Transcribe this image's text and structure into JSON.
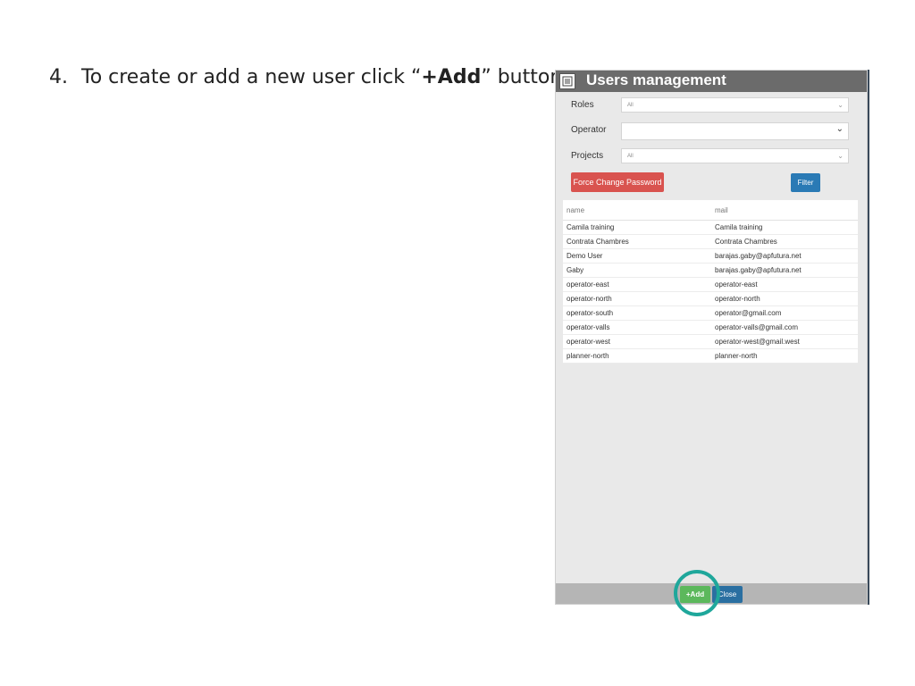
{
  "instruction": {
    "number": "4.",
    "before": "To create or add a new user click “",
    "emphasis": "+Add",
    "after": "” button."
  },
  "window": {
    "title": "Users management",
    "title_icon": "list-icon"
  },
  "filters": {
    "roles_label": "Roles",
    "roles_value": "All",
    "operator_label": "Operator",
    "operator_value": "",
    "projects_label": "Projects",
    "projects_value": "All"
  },
  "buttons": {
    "force_change_password": "Force Change Password",
    "filter": "Filter",
    "add": "+Add",
    "close": "Close"
  },
  "table": {
    "columns": [
      "name",
      "mail"
    ],
    "rows": [
      [
        "Camila training",
        "Camila training"
      ],
      [
        "Contrata Chambres",
        "Contrata Chambres"
      ],
      [
        "Demo User",
        "barajas.gaby@apfutura.net"
      ],
      [
        "Gaby",
        "barajas.gaby@apfutura.net"
      ],
      [
        "operator-east",
        "operator-east"
      ],
      [
        "operator-north",
        "operator-north"
      ],
      [
        "operator-south",
        "operator@gmail.com"
      ],
      [
        "operator-valls",
        "operator-valls@gmail.com"
      ],
      [
        "operator-west",
        "operator-west@gmail.west"
      ],
      [
        "planner-north",
        "planner-north"
      ]
    ]
  },
  "colors": {
    "highlight_ring": "#1fa79b",
    "add_button": "#5cb85c",
    "force_button": "#d9534f",
    "filter_button": "#2a7ab5"
  }
}
